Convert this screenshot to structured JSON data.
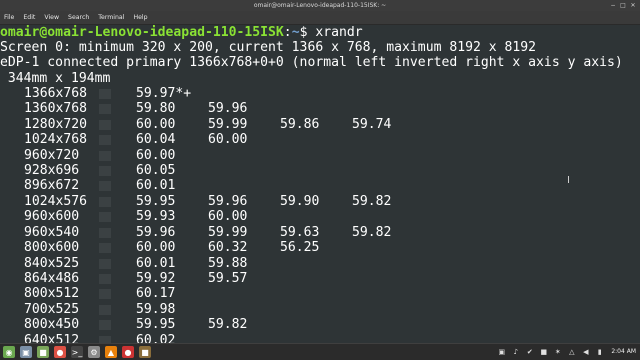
{
  "window": {
    "title": "omair@omair-Lenovo-ideapad-110-15ISK: ~"
  },
  "menubar": {
    "items": [
      "File",
      "Edit",
      "View",
      "Search",
      "Terminal",
      "Help"
    ]
  },
  "terminal": {
    "prompt_user_host": "omair@omair-Lenovo-ideapad-110-15ISK",
    "prompt_colon": ":",
    "prompt_path": "~",
    "prompt_dollar": "$ ",
    "command": "xrandr",
    "screen_line": "Screen 0: minimum 320 x 200, current 1366 x 768, maximum 8192 x 8192",
    "output_line": "eDP-1 connected primary 1366x768+0+0 (normal left inverted right x axis y axis)",
    "size_line": " 344mm x 194mm",
    "modes": [
      {
        "res": "1366x768",
        "rates": [
          "59.97*+"
        ]
      },
      {
        "res": "1360x768",
        "rates": [
          "59.80",
          "59.96"
        ]
      },
      {
        "res": "1280x720",
        "rates": [
          "60.00",
          "59.99",
          "59.86",
          "59.74"
        ]
      },
      {
        "res": "1024x768",
        "rates": [
          "60.04",
          "60.00"
        ]
      },
      {
        "res": "960x720",
        "rates": [
          "60.00"
        ]
      },
      {
        "res": "928x696",
        "rates": [
          "60.05"
        ]
      },
      {
        "res": "896x672",
        "rates": [
          "60.01"
        ]
      },
      {
        "res": "1024x576",
        "rates": [
          "59.95",
          "59.96",
          "59.90",
          "59.82"
        ]
      },
      {
        "res": "960x600",
        "rates": [
          "59.93",
          "60.00"
        ]
      },
      {
        "res": "960x540",
        "rates": [
          "59.96",
          "59.99",
          "59.63",
          "59.82"
        ]
      },
      {
        "res": "800x600",
        "rates": [
          "60.00",
          "60.32",
          "56.25"
        ]
      },
      {
        "res": "840x525",
        "rates": [
          "60.01",
          "59.88"
        ]
      },
      {
        "res": "864x486",
        "rates": [
          "59.92",
          "59.57"
        ]
      },
      {
        "res": "800x512",
        "rates": [
          "60.17"
        ]
      },
      {
        "res": "700x525",
        "rates": [
          "59.98"
        ]
      },
      {
        "res": "800x450",
        "rates": [
          "59.95",
          "59.82"
        ]
      },
      {
        "res": "640x512",
        "rates": [
          "60.02"
        ]
      }
    ]
  },
  "taskbar": {
    "launchers": [
      {
        "name": "menu-icon",
        "glyph": "◉",
        "color": "#6aa84f"
      },
      {
        "name": "show-desktop-icon",
        "glyph": "▣",
        "color": "#7a8fa6"
      },
      {
        "name": "files-icon",
        "glyph": "■",
        "color": "#7aa65a"
      },
      {
        "name": "chrome-icon",
        "glyph": "●",
        "color": "#dd5144"
      },
      {
        "name": "terminal-icon",
        "glyph": ">_",
        "color": "#444444"
      },
      {
        "name": "settings-icon",
        "glyph": "⚙",
        "color": "#8a8a8a"
      },
      {
        "name": "vlc-icon",
        "glyph": "▲",
        "color": "#e8810c"
      },
      {
        "name": "screen-recorder-icon",
        "glyph": "●",
        "color": "#cc3333"
      },
      {
        "name": "app-icon",
        "glyph": "■",
        "color": "#8a6d3b"
      }
    ],
    "tray": [
      {
        "name": "network-icon",
        "glyph": "▣"
      },
      {
        "name": "sound-icon",
        "glyph": "♪"
      },
      {
        "name": "update-icon",
        "glyph": "✔"
      },
      {
        "name": "lock-icon",
        "glyph": "■"
      },
      {
        "name": "bluetooth-icon",
        "glyph": "✶"
      },
      {
        "name": "wifi-icon",
        "glyph": "△"
      },
      {
        "name": "volume-icon",
        "glyph": "◀"
      },
      {
        "name": "battery-icon",
        "glyph": "▮"
      }
    ],
    "clock": "2:04 AM"
  }
}
